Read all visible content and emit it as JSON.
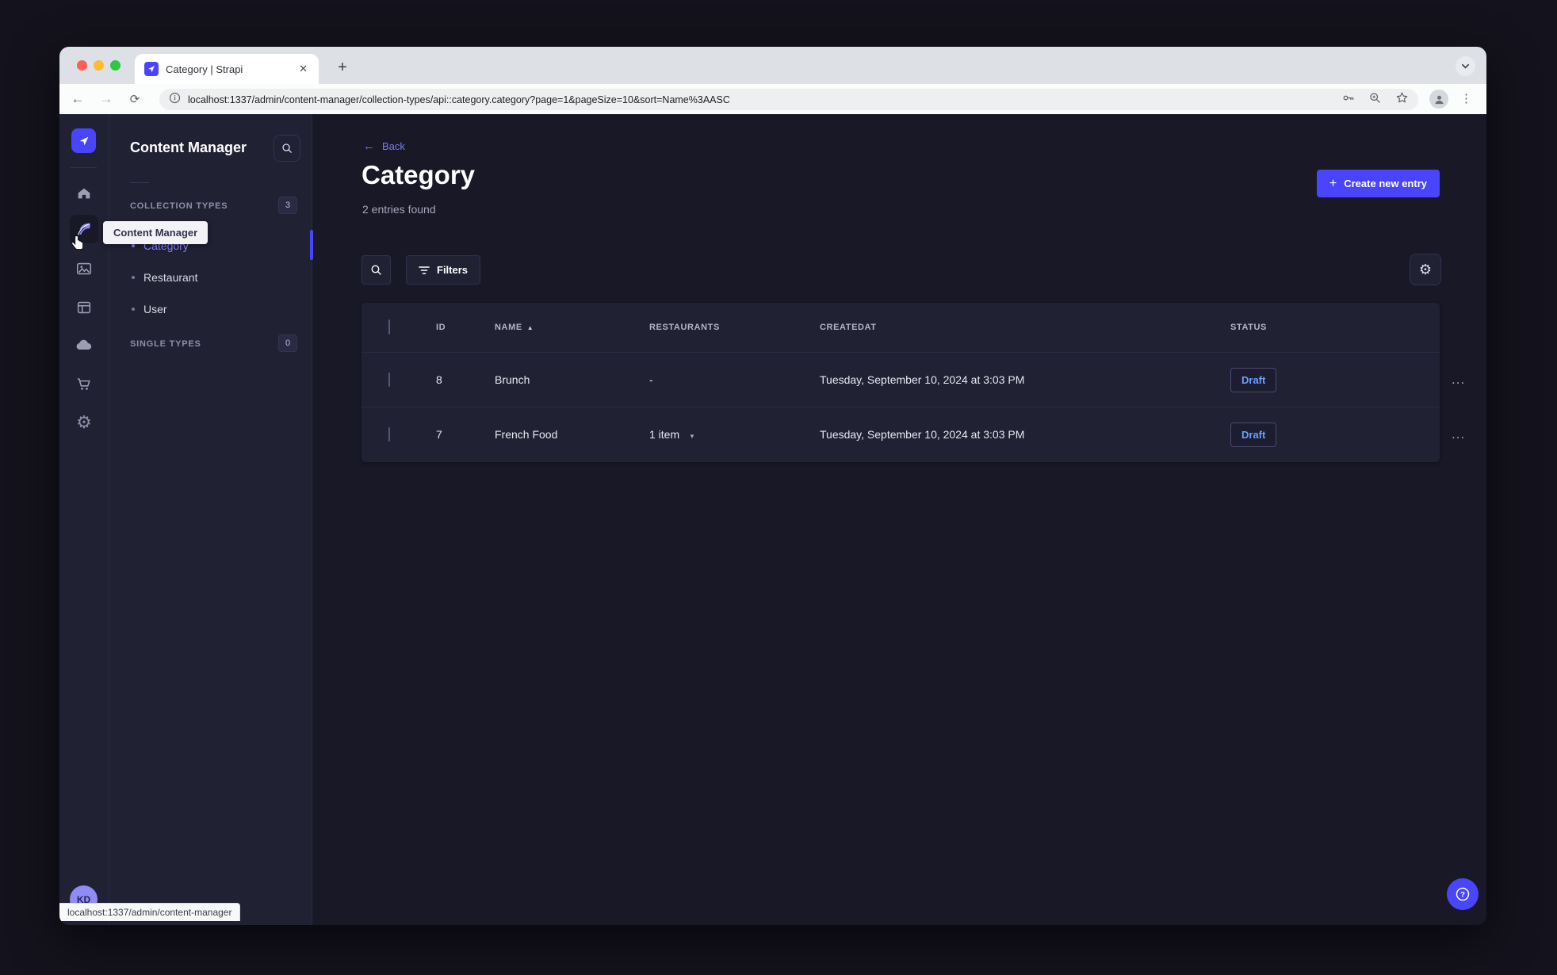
{
  "colors": {
    "primary": "#4945ff",
    "primary_light": "#7b79ff",
    "surface": "#212134",
    "background": "#181826",
    "draft_text": "#6c9eff"
  },
  "browser": {
    "tab_title": "Category | Strapi",
    "url": "localhost:1337/admin/content-manager/collection-types/api::category.category?page=1&pageSize=10&sort=Name%3AASC",
    "status_bar_link": "localhost:1337/admin/content-manager",
    "new_tab_label": "+",
    "close_tab_label": "✕",
    "back_glyph": "←",
    "forward_glyph": "→",
    "reload_glyph": "⟳",
    "menu_glyph": "⋮"
  },
  "rail": {
    "tooltip": "Content Manager",
    "avatar_initials": "KD",
    "icons": [
      "strapi-logo",
      "home",
      "content-manager",
      "media-library",
      "content-type-builder",
      "cloud",
      "marketplace",
      "settings"
    ],
    "gear_glyph": "⚙"
  },
  "subnav": {
    "title": "Content Manager",
    "collection_types": {
      "label": "COLLECTION TYPES",
      "badge": "3",
      "items": [
        {
          "label": "Category",
          "active": true
        },
        {
          "label": "Restaurant",
          "active": false
        },
        {
          "label": "User",
          "active": false
        }
      ]
    },
    "single_types": {
      "label": "SINGLE TYPES",
      "badge": "0"
    }
  },
  "main": {
    "back_label": "Back",
    "back_glyph": "←",
    "title": "Category",
    "subtitle": "2 entries found",
    "create_button": "Create new entry",
    "create_plus": "+",
    "filters_button": "Filters",
    "table": {
      "headers": {
        "id": "ID",
        "name": "NAME",
        "restaurants": "RESTAURANTS",
        "createdat": "CREATEDAT",
        "status": "STATUS"
      },
      "sort_caret": "▲",
      "rows": [
        {
          "id": "8",
          "name": "Brunch",
          "restaurants": "-",
          "created": "Tuesday, September 10, 2024 at 3:03 PM",
          "status": "Draft",
          "actions": "..."
        },
        {
          "id": "7",
          "name": "French Food",
          "restaurants": "1 item",
          "restaurants_chevron": "▼",
          "created": "Tuesday, September 10, 2024 at 3:03 PM",
          "status": "Draft",
          "actions": "..."
        }
      ]
    }
  }
}
